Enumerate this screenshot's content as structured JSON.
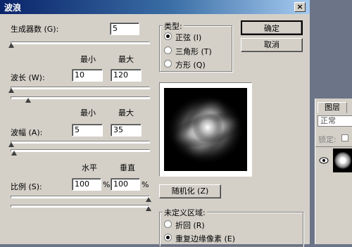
{
  "dialog": {
    "title": "波浪",
    "close_glyph": "×",
    "generators": {
      "label": "生成器数 (G):",
      "value": "5",
      "slider_fraction": 0.0
    },
    "wavelength": {
      "min_header": "最小",
      "max_header": "最大",
      "label": "波长 (W):",
      "min": "10",
      "max": "120",
      "min_slider_fraction": 0.0,
      "max_slider_fraction": 0.12
    },
    "amplitude": {
      "min_header": "最小",
      "max_header": "最大",
      "label": "波幅 (A):",
      "min": "5",
      "max": "35",
      "min_slider_fraction": 0.0,
      "max_slider_fraction": 0.02
    },
    "scale": {
      "h_header": "水平",
      "v_header": "垂直",
      "label": "比例 (S):",
      "horizontal": "100",
      "vertical": "100",
      "percent": "%",
      "h_slider_fraction": 1.0,
      "v_slider_fraction": 1.0
    },
    "type": {
      "title": "类型:",
      "options": [
        {
          "label": "正弦 (I)",
          "selected": true
        },
        {
          "label": "三角形 (T)",
          "selected": false
        },
        {
          "label": "方形 (Q)",
          "selected": false
        }
      ]
    },
    "ok_label": "确定",
    "cancel_label": "取消",
    "randomize_label": "随机化 (Z)",
    "undefined_area": {
      "title": "未定义区域:",
      "options": [
        {
          "label": "折回 (R)",
          "selected": false
        },
        {
          "label": "重复边缘像素 (E)",
          "selected": true
        }
      ]
    }
  },
  "layers_panel": {
    "tab_label": "图层",
    "blend_mode": "正常",
    "lock_label": "锁定:"
  },
  "colors": {
    "title_bar": "#0a246a",
    "dialog_bg": "#d4d0c8"
  }
}
